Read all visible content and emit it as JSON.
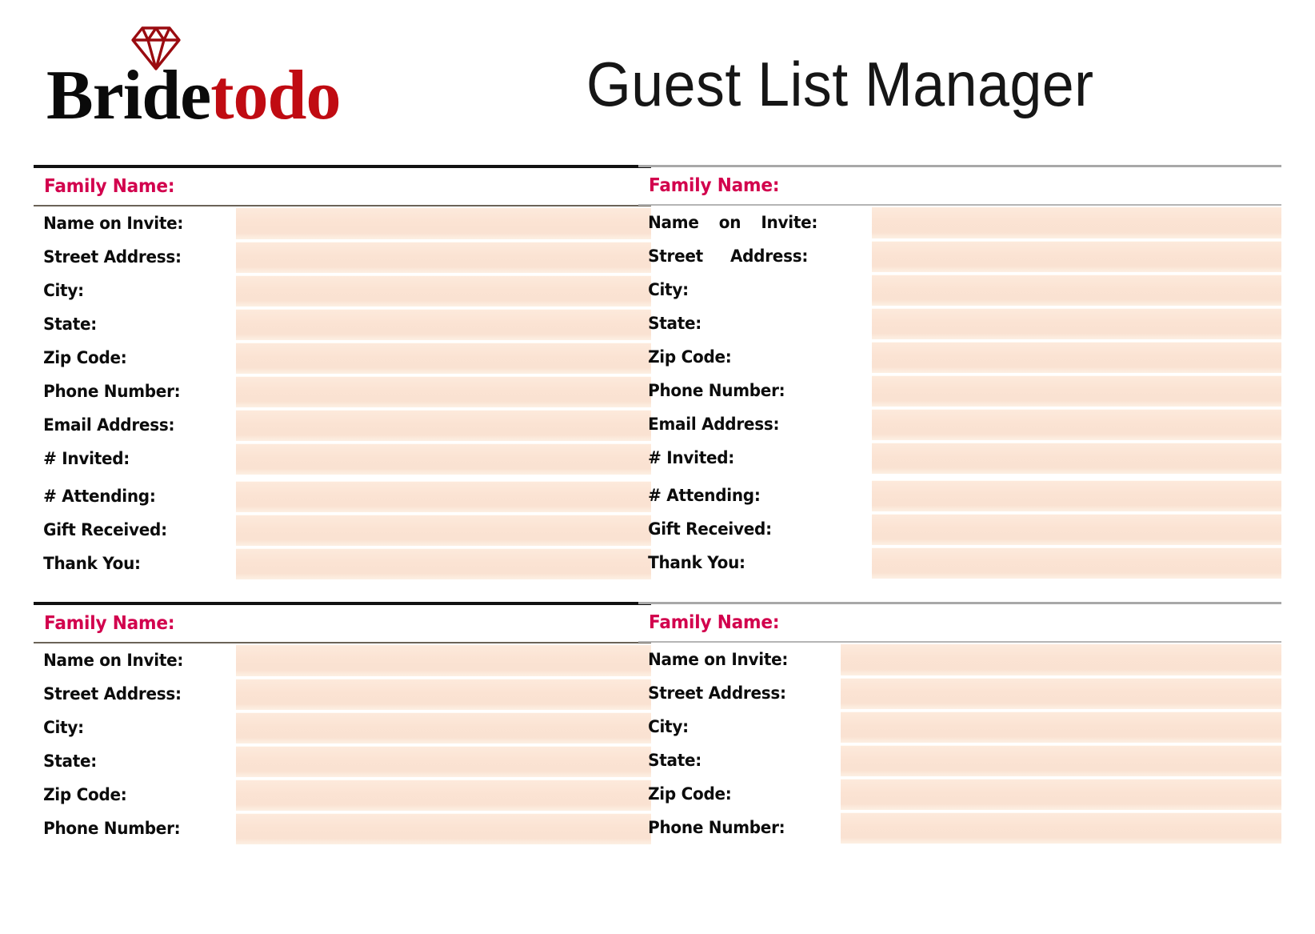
{
  "header": {
    "logo": {
      "part1": "Bride",
      "part2": "todo",
      "icon": "diamond-icon",
      "color_black": "#0a0a0a",
      "color_red": "#c00b12"
    },
    "title": "Guest List Manager"
  },
  "theme": {
    "family_name_color": "#d2004d",
    "input_fill": "#fbe3d3",
    "label_color": "#0c0c0c",
    "rule_color": "#111111"
  },
  "cards": [
    {
      "id": "card-top-left",
      "family_name_label": "Family Name:",
      "family_name_value": "",
      "fields": [
        {
          "label": "Name on Invite:",
          "value": ""
        },
        {
          "label": "Street  Address:",
          "value": ""
        },
        {
          "label": "City:",
          "value": ""
        },
        {
          "label": "State:",
          "value": ""
        },
        {
          "label": "Zip Code:",
          "value": ""
        },
        {
          "label": "Phone Number:",
          "value": ""
        },
        {
          "label": "Email Address:",
          "value": ""
        },
        {
          "label": "# Invited:",
          "value": ""
        },
        {
          "label": "# Attending:",
          "value": ""
        },
        {
          "label": "Gift Received:",
          "value": ""
        },
        {
          "label": "Thank You:",
          "value": ""
        }
      ]
    },
    {
      "id": "card-top-right",
      "family_name_label": "Family Name:",
      "family_name_value": "",
      "fields": [
        {
          "label": "Name on Invite:",
          "value": ""
        },
        {
          "label": "Street Address:",
          "value": ""
        },
        {
          "label": "City:",
          "value": ""
        },
        {
          "label": "State:",
          "value": ""
        },
        {
          "label": "Zip Code:",
          "value": ""
        },
        {
          "label": "Phone Number:",
          "value": ""
        },
        {
          "label": "Email Address:",
          "value": ""
        },
        {
          "label": "# Invited:",
          "value": ""
        },
        {
          "label": "# Attending:",
          "value": ""
        },
        {
          "label": "Gift Received:",
          "value": ""
        },
        {
          "label": "Thank You:",
          "value": ""
        }
      ]
    },
    {
      "id": "card-bottom-left",
      "family_name_label": "Family Name:",
      "family_name_value": "",
      "fields": [
        {
          "label": "Name on Invite:",
          "value": ""
        },
        {
          "label": "Street Address:",
          "value": ""
        },
        {
          "label": "City:",
          "value": ""
        },
        {
          "label": "State:",
          "value": ""
        },
        {
          "label": "Zip Code:",
          "value": ""
        },
        {
          "label": "Phone Number:",
          "value": ""
        }
      ]
    },
    {
      "id": "card-bottom-right",
      "family_name_label": "Family Name:",
      "family_name_value": "",
      "fields": [
        {
          "label": "Name on Invite:",
          "value": ""
        },
        {
          "label": "Street Address:",
          "value": ""
        },
        {
          "label": "City:",
          "value": ""
        },
        {
          "label": "State:",
          "value": ""
        },
        {
          "label": "Zip Code:",
          "value": ""
        },
        {
          "label": "Phone Number:",
          "value": ""
        }
      ]
    }
  ]
}
